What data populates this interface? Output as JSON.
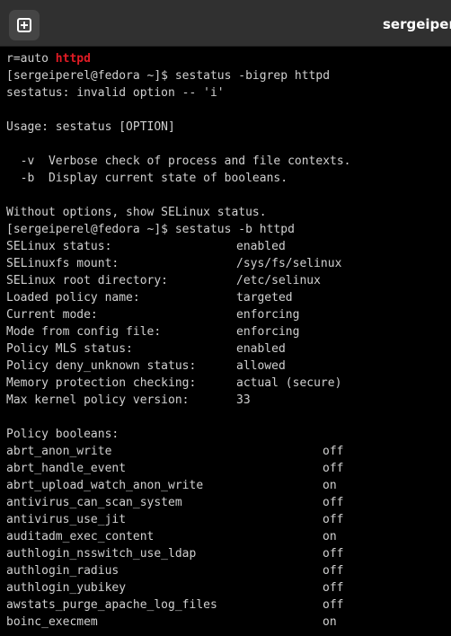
{
  "window": {
    "title": "sergeiperel@fedora:~"
  },
  "terminal": {
    "line_prev_prefix": "r=auto ",
    "line_prev_highlight": "httpd",
    "cmd1": "[sergeiperel@fedora ~]$ sestatus -bigrep httpd",
    "err1": "sestatus: invalid option -- 'i'",
    "blank1": "",
    "usage": "Usage: sestatus [OPTION]",
    "blank2": "",
    "opt_v": "  -v  Verbose check of process and file contexts.",
    "opt_b": "  -b  Display current state of booleans.",
    "blank3": "",
    "without": "Without options, show SELinux status.",
    "cmd2": "[sergeiperel@fedora ~]$ sestatus -b httpd",
    "status_rows": [
      {
        "key": "SELinux status:",
        "value": "enabled"
      },
      {
        "key": "SELinuxfs mount:",
        "value": "/sys/fs/selinux"
      },
      {
        "key": "SELinux root directory:",
        "value": "/etc/selinux"
      },
      {
        "key": "Loaded policy name:",
        "value": "targeted"
      },
      {
        "key": "Current mode:",
        "value": "enforcing"
      },
      {
        "key": "Mode from config file:",
        "value": "enforcing"
      },
      {
        "key": "Policy MLS status:",
        "value": "enabled"
      },
      {
        "key": "Policy deny_unknown status:",
        "value": "allowed"
      },
      {
        "key": "Memory protection checking:",
        "value": "actual (secure)"
      },
      {
        "key": "Max kernel policy version:",
        "value": "33"
      }
    ],
    "blank4": "",
    "booleans_header": "Policy booleans:",
    "boolean_rows": [
      {
        "name": "abrt_anon_write",
        "state": "off"
      },
      {
        "name": "abrt_handle_event",
        "state": "off"
      },
      {
        "name": "abrt_upload_watch_anon_write",
        "state": "on"
      },
      {
        "name": "antivirus_can_scan_system",
        "state": "off"
      },
      {
        "name": "antivirus_use_jit",
        "state": "off"
      },
      {
        "name": "auditadm_exec_content",
        "state": "on"
      },
      {
        "name": "authlogin_nsswitch_use_ldap",
        "state": "off"
      },
      {
        "name": "authlogin_radius",
        "state": "off"
      },
      {
        "name": "authlogin_yubikey",
        "state": "off"
      },
      {
        "name": "awstats_purge_apache_log_files",
        "state": "off"
      },
      {
        "name": "boinc_execmem",
        "state": "on"
      }
    ]
  },
  "colors": {
    "background": "#000000",
    "text": "#d0d0d0",
    "highlight": "#e01b24",
    "headerbar": "#303030"
  },
  "icons": {
    "new_tab": "new-tab-icon"
  }
}
